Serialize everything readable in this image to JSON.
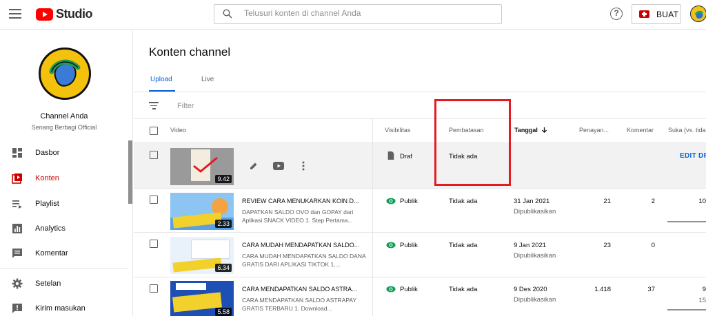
{
  "topbar": {
    "logo_text": "Studio",
    "search_placeholder": "Telusuri konten di channel Anda",
    "help_symbol": "?",
    "create_label": "BUAT"
  },
  "sidebar": {
    "channel_name": "Channel Anda",
    "channel_subtitle": "Senang Berbagi Official",
    "items": [
      {
        "label": "Dasbor",
        "icon": "dashboard-icon"
      },
      {
        "label": "Konten",
        "icon": "content-icon",
        "active": true
      },
      {
        "label": "Playlist",
        "icon": "playlist-icon"
      },
      {
        "label": "Analytics",
        "icon": "analytics-icon"
      },
      {
        "label": "Komentar",
        "icon": "comments-icon"
      },
      {
        "label": "Setelan",
        "icon": "settings-icon"
      },
      {
        "label": "Kirim masukan",
        "icon": "feedback-icon"
      }
    ]
  },
  "main": {
    "title": "Konten channel",
    "tabs": [
      {
        "label": "Upload",
        "active": true
      },
      {
        "label": "Live"
      }
    ],
    "filter_placeholder": "Filter",
    "columns": {
      "video": "Video",
      "visibility": "Visibilitas",
      "restriction": "Pembatasan",
      "date": "Tanggal",
      "views": "Penayan...",
      "comments": "Komentar",
      "likes": "Suka (vs. tida"
    },
    "rows": [
      {
        "type": "draft",
        "duration": "9.42",
        "visibility": "Draf",
        "restriction": "Tidak ada",
        "action": "EDIT DR"
      },
      {
        "title": "REVIEW CARA MENUKARKAN KOIN D...",
        "desc": "DAPATKAN SALDO OVO dan GOPAY dari Aplikasi SNACK VIDEO 1. Step Pertama...",
        "duration": "2.33",
        "visibility": "Publik",
        "restriction": "Tidak ada",
        "date": "31 Jan 2021",
        "date_status": "Dipublikasikan",
        "views": "21",
        "comments": "2",
        "likes": "10"
      },
      {
        "title": "CARA MUDAH MENDAPATKAN SALDO...",
        "desc": "CARA MUDAH MENDAPATKAN SALDO DANA GRATIS DARI APLIKASI TIKTOK 1....",
        "duration": "6.34",
        "visibility": "Publik",
        "restriction": "Tidak ada",
        "date": "9 Jan 2021",
        "date_status": "Dipublikasikan",
        "views": "23",
        "comments": "0",
        "likes": ""
      },
      {
        "title": "CARA MENDAPATKAN SALDO ASTRA...",
        "desc": "CARA MENDAPATKAN SALDO ASTRAPAY GRATIS TERBARU 1. Download...",
        "duration": "5.58",
        "visibility": "Publik",
        "restriction": "Tidak ada",
        "date": "9 Des 2020",
        "date_status": "Dipublikasikan",
        "views": "1.418",
        "comments": "37",
        "likes": "9",
        "likes_sub": "15"
      }
    ]
  },
  "colors": {
    "accent_red": "#cc0000",
    "link_blue": "#065fd4",
    "annotation_red": "#e31b23",
    "public_green": "#0f9d58"
  }
}
